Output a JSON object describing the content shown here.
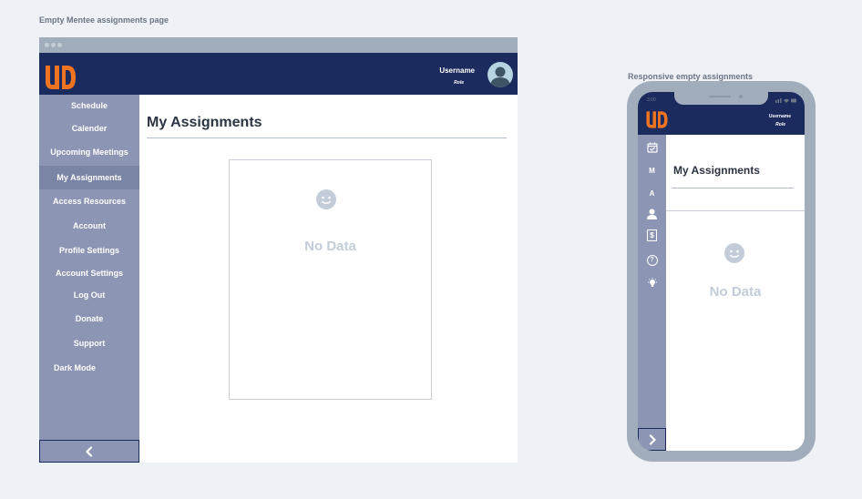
{
  "captions": {
    "desktop": "Empty Mentee assignments page",
    "mobile": "Responsive empty assignments"
  },
  "header": {
    "username": "Username",
    "role": "Role"
  },
  "sidebar": {
    "items": [
      {
        "label": "Schedule"
      },
      {
        "label": "Calender"
      },
      {
        "label": "Upcoming Meetings"
      },
      {
        "label": "My Assignments",
        "active": true
      },
      {
        "label": "Access Resources"
      },
      {
        "label": "Account"
      },
      {
        "label": "Profile Settings"
      },
      {
        "label": "Account Settings"
      },
      {
        "label": "Log Out"
      },
      {
        "label": "Donate"
      },
      {
        "label": "Support"
      },
      {
        "label": "Dark Mode"
      }
    ],
    "collapse_icon": "chevron-left-icon"
  },
  "main": {
    "title": "My Assignments",
    "empty_text": "No Data",
    "empty_icon": "smiley-icon"
  },
  "mobile": {
    "status_time": "3:00",
    "header": {
      "username": "Username",
      "role": "Role"
    },
    "sidebar_icons": [
      {
        "name": "calendar-check-icon"
      },
      {
        "name": "meetings-icon",
        "glyph": "M"
      },
      {
        "name": "assignments-icon",
        "glyph": "A"
      },
      {
        "name": "user-icon"
      },
      {
        "name": "dollar-icon",
        "glyph": "$"
      },
      {
        "name": "help-icon",
        "glyph": "?"
      },
      {
        "name": "lightbulb-icon"
      }
    ],
    "expand_icon": "chevron-right-icon",
    "title": "My Assignments",
    "empty_text": "No Data"
  },
  "colors": {
    "header_bg": "#1b2b5e",
    "sidebar_bg": "#8c95b3",
    "brand_orange": "#ef7422",
    "empty_text": "#c3cdd9",
    "page_bg": "#eef1f5"
  }
}
